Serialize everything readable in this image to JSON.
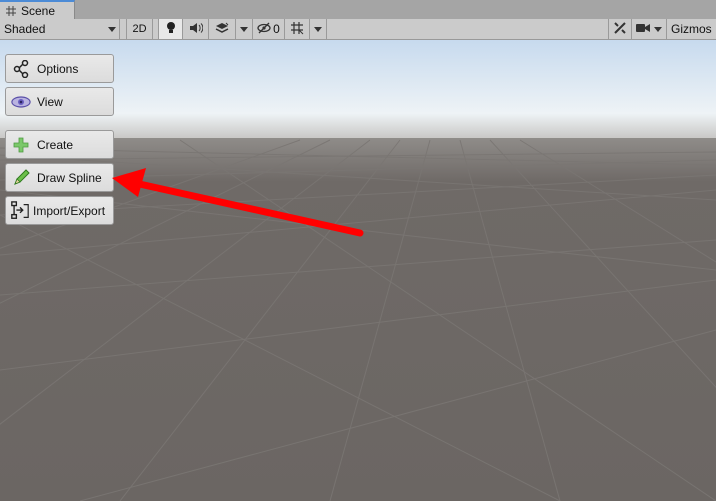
{
  "tab": {
    "label": "Scene"
  },
  "toolbar": {
    "shading_mode": "Shaded",
    "mode_2d": "2D",
    "hidden_count": "0",
    "gizmos": "Gizmos"
  },
  "side_buttons": {
    "options": "Options",
    "view": "View",
    "create": "Create",
    "draw_spline": "Draw Spline",
    "import_export": "Import/Export"
  },
  "colors": {
    "sky_top": "#c9dbee",
    "horizon": "#eaf1f6",
    "ground": "#6b6663",
    "grid": "#7a7673",
    "annotation_arrow": "#ff0000",
    "tab_accent": "#4c8bd6"
  }
}
